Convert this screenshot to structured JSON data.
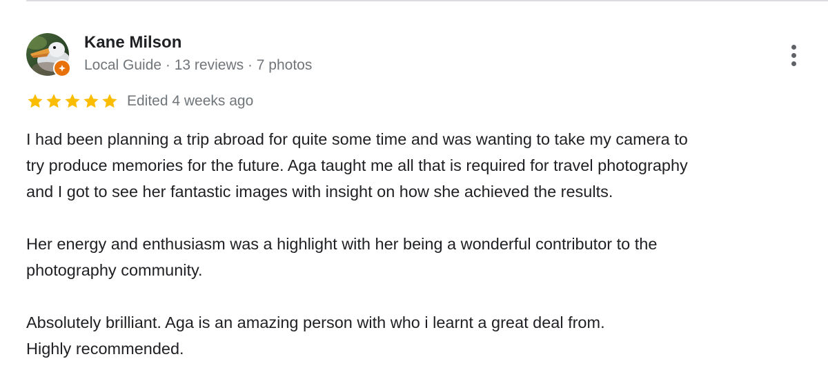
{
  "review": {
    "author": {
      "name": "Kane Milson",
      "meta": "Local Guide · 13 reviews · 7 photos",
      "avatar_icon": "duck-photo-avatar",
      "badge_icon": "local-guide-star-badge"
    },
    "rating": 5,
    "rating_max": 5,
    "date": "Edited 4 weeks ago",
    "paragraphs": [
      {
        "lines": [
          "I had been planning a trip abroad for quite some time and was wanting to take my camera to",
          "try produce memories for the future. Aga taught me all that is required for travel photography",
          "and I got to see her fantastic images with insight on how she achieved the results."
        ]
      },
      {
        "lines": [
          "Her energy and enthusiasm was a highlight with her being a wonderful contributor to the",
          "photography community."
        ]
      },
      {
        "lines": [
          "Absolutely brilliant. Aga is an amazing person with who i learnt a great deal from.",
          "Highly recommended."
        ]
      }
    ]
  },
  "colors": {
    "star": "#fbbc04",
    "meta_text": "#70757a",
    "body_text": "#202124",
    "badge": "#e8710a"
  },
  "icons": {
    "menu": "more-vert-icon",
    "star": "star-icon"
  }
}
